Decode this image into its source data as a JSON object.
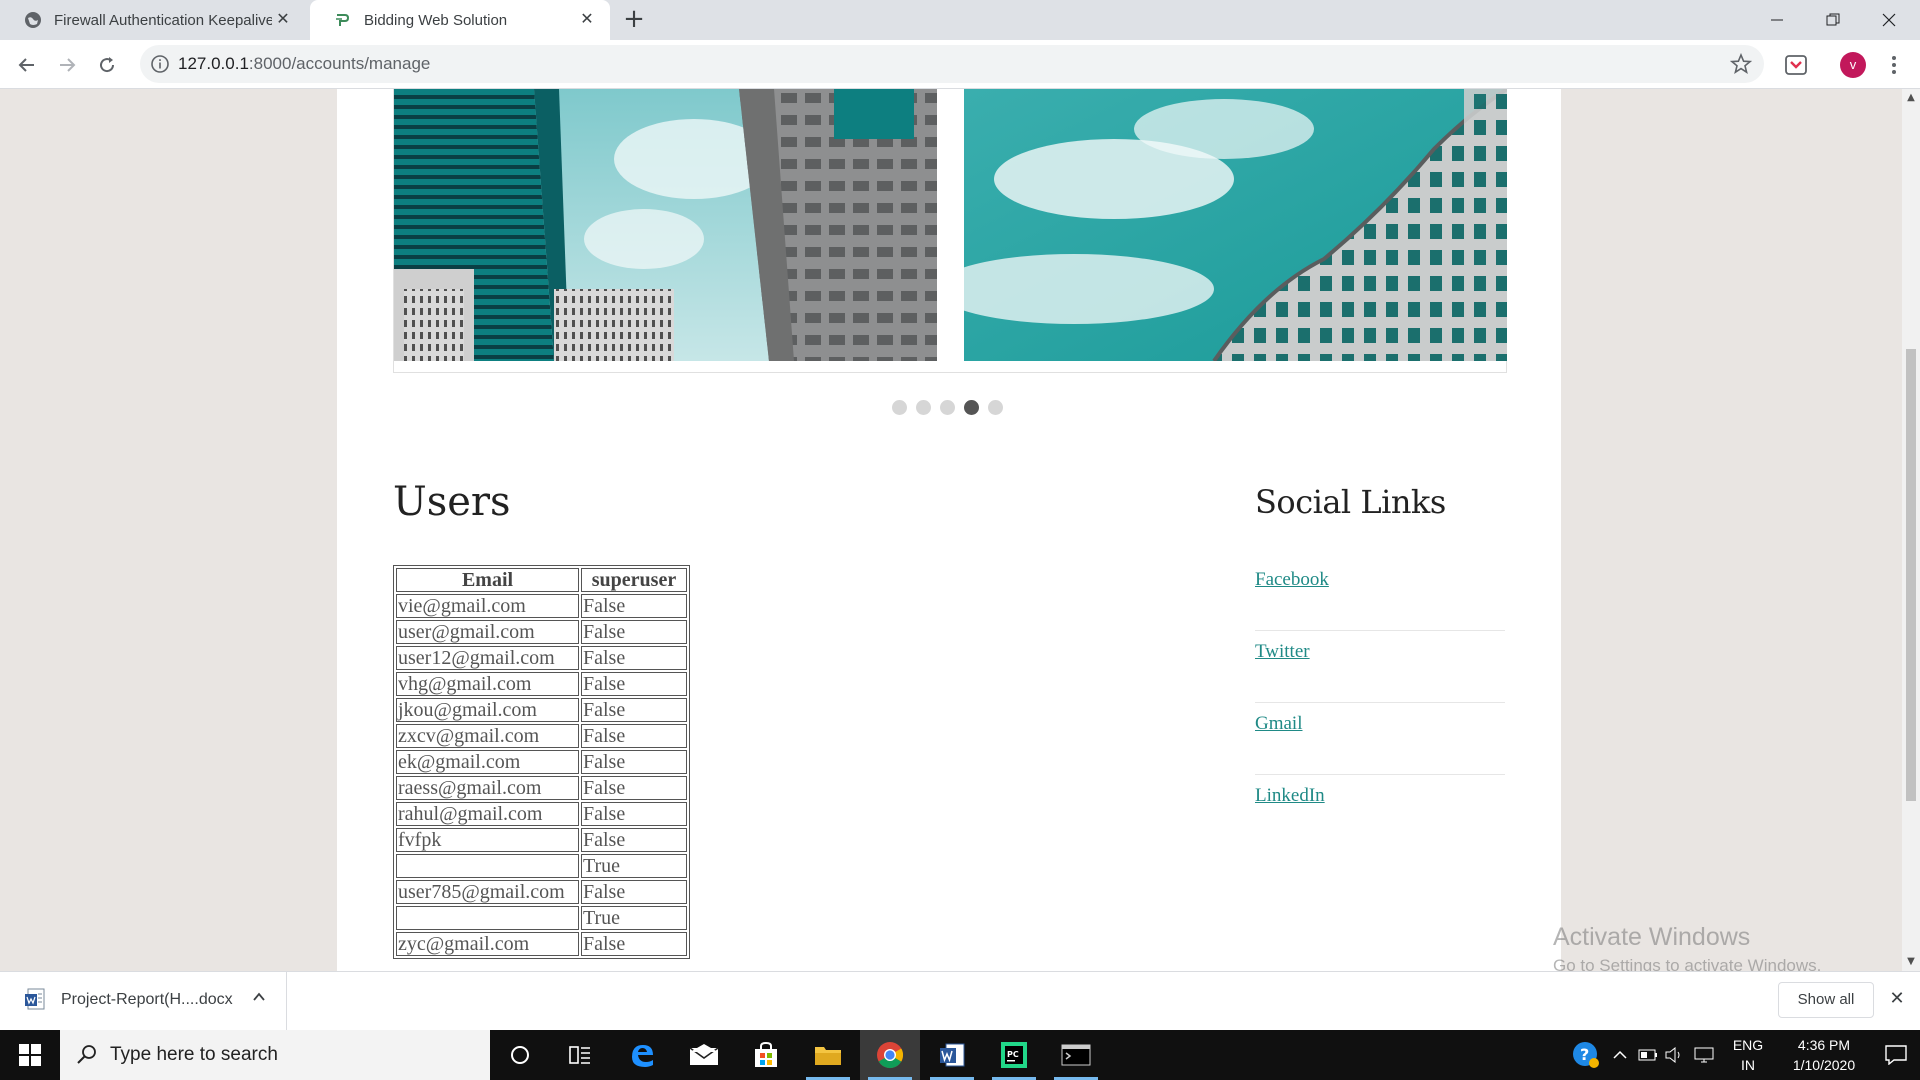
{
  "browser": {
    "tabs": [
      {
        "title": "Firewall Authentication Keepalive",
        "active": false
      },
      {
        "title": "Bidding Web Solution",
        "active": true
      }
    ],
    "url_host": "127.0.0.1",
    "url_path": ":8000/accounts/manage",
    "profile_initial": "v"
  },
  "carousel": {
    "dot_count": 5,
    "active_index": 3
  },
  "users": {
    "heading": "Users",
    "columns": [
      "Email",
      "superuser"
    ],
    "rows": [
      {
        "email": "vie@gmail.com",
        "superuser": "False"
      },
      {
        "email": "user@gmail.com",
        "superuser": "False"
      },
      {
        "email": "user12@gmail.com",
        "superuser": "False"
      },
      {
        "email": "vhg@gmail.com",
        "superuser": "False"
      },
      {
        "email": "jkou@gmail.com",
        "superuser": "False"
      },
      {
        "email": "zxcv@gmail.com",
        "superuser": "False"
      },
      {
        "email": "ek@gmail.com",
        "superuser": "False"
      },
      {
        "email": "raess@gmail.com",
        "superuser": "False"
      },
      {
        "email": "rahul@gmail.com",
        "superuser": "False"
      },
      {
        "email": "fvfpk",
        "superuser": "False"
      },
      {
        "email": "",
        "superuser": "True"
      },
      {
        "email": "user785@gmail.com",
        "superuser": "False"
      },
      {
        "email": "",
        "superuser": "True"
      },
      {
        "email": "zyc@gmail.com",
        "superuser": "False"
      }
    ]
  },
  "social": {
    "heading": "Social Links",
    "links": [
      "Facebook",
      "Twitter",
      "Gmail",
      "LinkedIn"
    ]
  },
  "watermark": {
    "line1": "Activate Windows",
    "line2": "Go to Settings to activate Windows."
  },
  "downloads": {
    "file_name": "Project-Report(H....docx",
    "show_all": "Show all"
  },
  "taskbar": {
    "search_placeholder": "Type here to search",
    "lang_line1": "ENG",
    "lang_line2": "IN",
    "time": "4:36 PM",
    "date": "1/10/2020"
  },
  "colors": {
    "link": "#1f8a86",
    "profile": "#c2185b",
    "taskbar": "#101010"
  }
}
